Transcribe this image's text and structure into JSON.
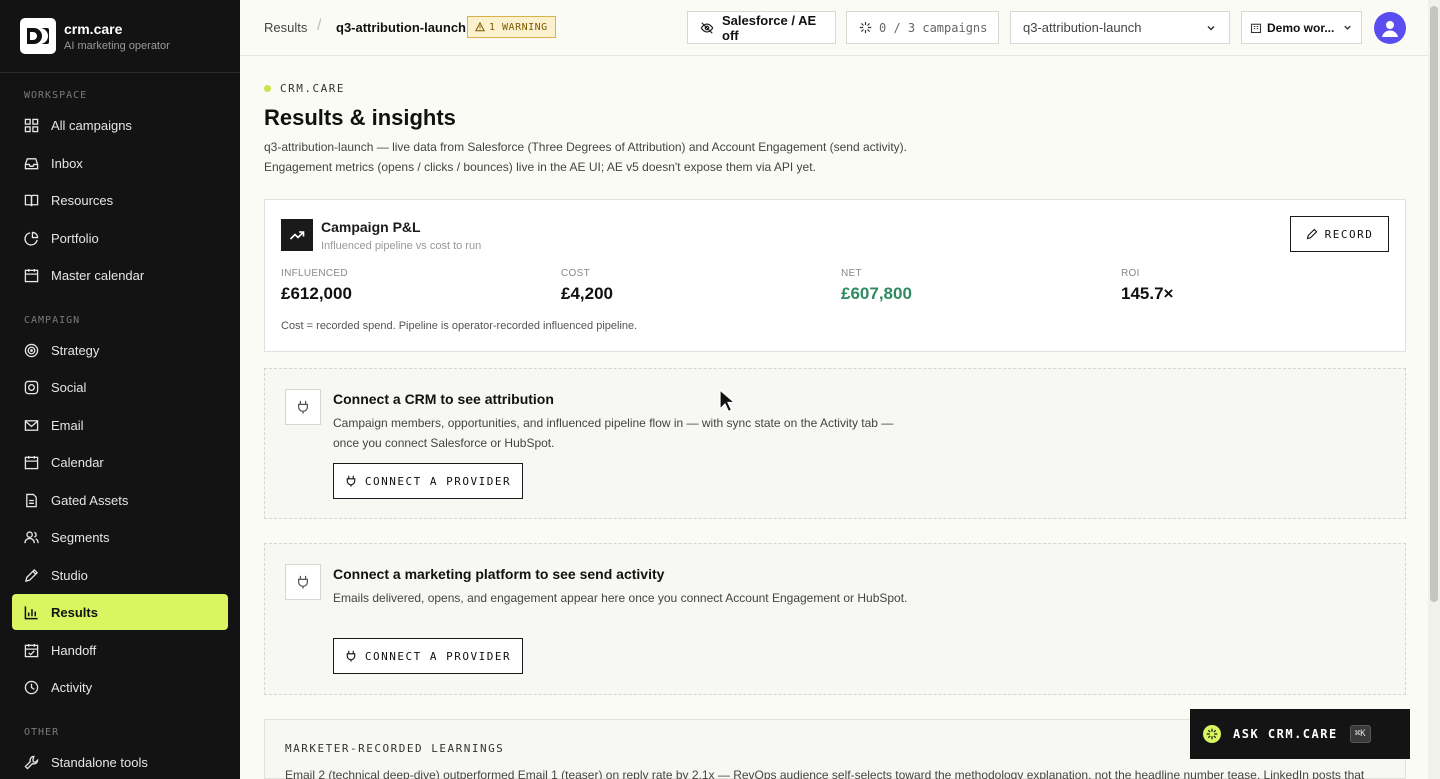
{
  "brand": {
    "name": "crm.care",
    "tagline": "AI marketing operator"
  },
  "sidebar": {
    "sections": {
      "workspace": "WORKSPACE",
      "campaign": "CAMPAIGN",
      "other": "OTHER"
    },
    "items": [
      {
        "label": "All campaigns",
        "icon": "grid-icon"
      },
      {
        "label": "Inbox",
        "icon": "inbox-icon"
      },
      {
        "label": "Resources",
        "icon": "book-icon"
      },
      {
        "label": "Portfolio",
        "icon": "pie-chart-icon"
      },
      {
        "label": "Master calendar",
        "icon": "calendar-icon"
      },
      {
        "label": "Strategy",
        "icon": "target-icon"
      },
      {
        "label": "Social",
        "icon": "social-icon"
      },
      {
        "label": "Email",
        "icon": "mail-icon"
      },
      {
        "label": "Calendar",
        "icon": "calendar-icon"
      },
      {
        "label": "Gated Assets",
        "icon": "file-icon"
      },
      {
        "label": "Segments",
        "icon": "users-icon"
      },
      {
        "label": "Studio",
        "icon": "pen-icon"
      },
      {
        "label": "Results",
        "icon": "bar-chart-icon",
        "active": true
      },
      {
        "label": "Handoff",
        "icon": "handoff-icon"
      },
      {
        "label": "Activity",
        "icon": "activity-icon"
      },
      {
        "label": "Standalone tools",
        "icon": "wrench-icon"
      }
    ]
  },
  "topbar": {
    "breadcrumb_root": "Results",
    "breadcrumb_separator": "/",
    "breadcrumb_current": "q3-attribution-launch",
    "warning_badge": "1 WARNING",
    "integration_status": "Salesforce / AE off",
    "campaign_count": "0 / 3 campaigns",
    "campaign_select_value": "q3-attribution-launch",
    "workspace_select_value": "Demo wor..."
  },
  "page": {
    "eyebrow": "CRM.CARE",
    "title": "Results & insights",
    "description_line1": "q3-attribution-launch — live data from Salesforce (Three Degrees of Attribution) and Account Engagement (send activity).",
    "description_line2": "Engagement metrics (opens / clicks / bounces) live in the AE UI; AE v5 doesn't expose them via API yet."
  },
  "pl_card": {
    "title": "Campaign P&L",
    "subtitle": "Influenced pipeline vs cost to run",
    "record_button": "RECORD",
    "metrics": [
      {
        "label": "INFLUENCED",
        "value": "£612,000"
      },
      {
        "label": "COST",
        "value": "£4,200"
      },
      {
        "label": "NET",
        "value": "£607,800",
        "color": "#2f8a63"
      },
      {
        "label": "ROI",
        "value": "145.7×"
      }
    ],
    "note": "Cost = recorded spend. Pipeline is operator-recorded influenced pipeline."
  },
  "crm_card": {
    "title": "Connect a CRM to see attribution",
    "body": "Campaign members, opportunities, and influenced pipeline flow in — with sync state on the Activity tab — once you connect Salesforce or HubSpot.",
    "button": "CONNECT A PROVIDER"
  },
  "marketing_card": {
    "title": "Connect a marketing platform to see send activity",
    "body": "Emails delivered, opens, and engagement appear here once you connect Account Engagement or HubSpot.",
    "button": "CONNECT A PROVIDER"
  },
  "learnings": {
    "title": "MARKETER-RECORDED LEARNINGS",
    "body": "Email 2 (technical deep-dive) outperformed Email 1 (teaser) on reply rate by 2.1x — RevOps audience self-selects toward the methodology explanation, not the headline number tease. LinkedIn posts that"
  },
  "ask": {
    "label": "ASK CRM.CARE",
    "shortcut": "⌘K"
  },
  "colors": {
    "accent": "#d9f55f",
    "sidebar_bg": "#131313",
    "net_green": "#2f8a63",
    "avatar": "#5b4ef0"
  }
}
